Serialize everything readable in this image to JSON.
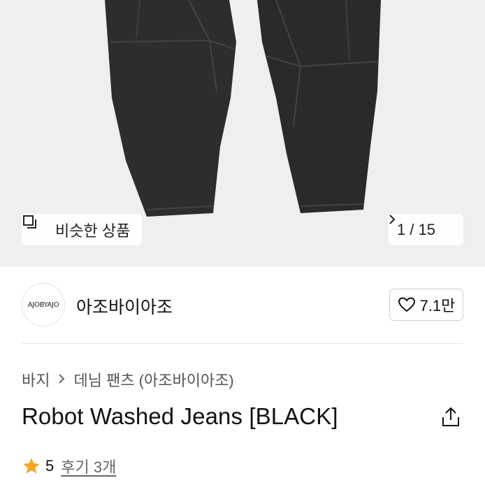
{
  "hero": {
    "similar_products_label": "비슷한 상품",
    "page_indicator": "1 / 15"
  },
  "brand": {
    "logo_text": "AJOBYAJO",
    "name": "아조바이아조",
    "likes": "7.1만"
  },
  "breadcrumb": {
    "items": [
      "바지",
      "데님 팬츠 (아조바이아조)"
    ]
  },
  "product": {
    "title": "Robot Washed Jeans [BLACK]"
  },
  "rating": {
    "score": "5",
    "reviews_label": "후기 3개"
  },
  "colors": {
    "star": "#f5a623",
    "hero_bg": "#efefef",
    "denim": "#2b2b2b"
  }
}
